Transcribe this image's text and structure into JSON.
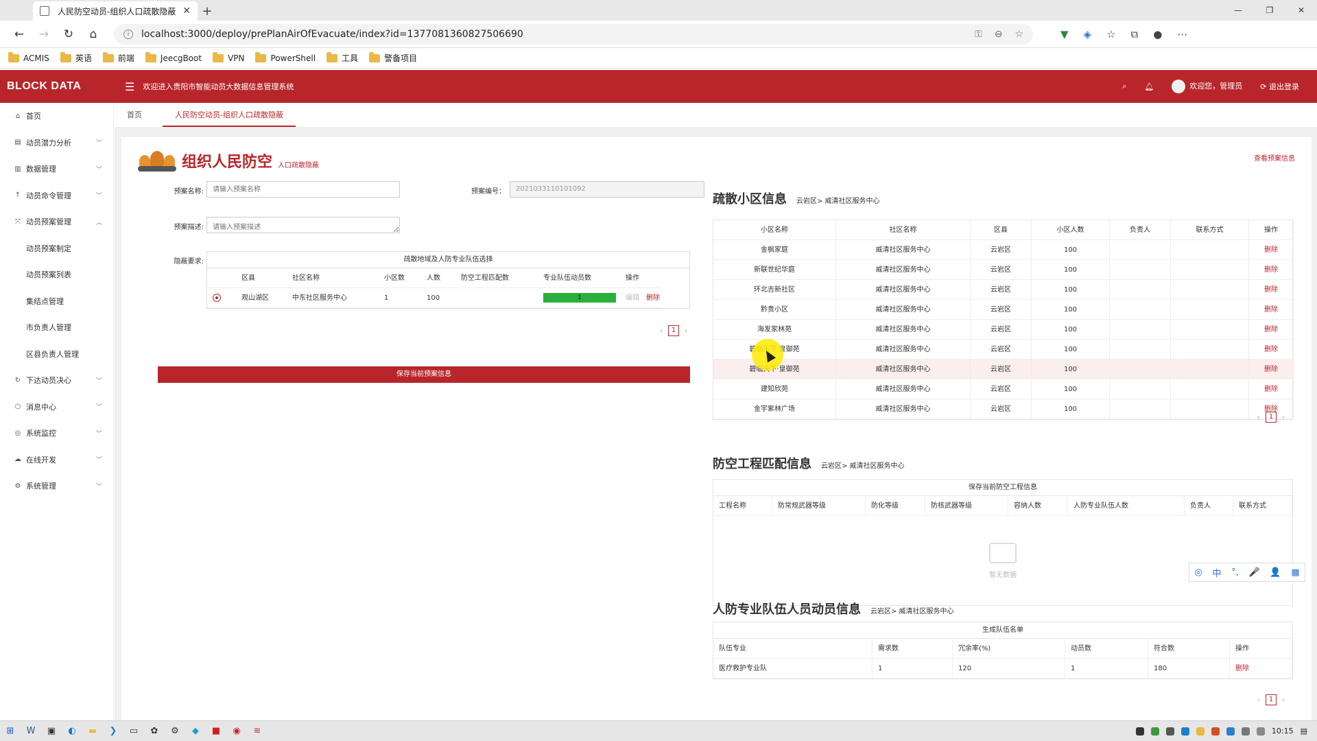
{
  "browser": {
    "tab_title": "人民防空动员-组织人口疏散隐蔽",
    "new_tab": "+",
    "url": "localhost:3000/deploy/prePlanAirOfEvacuate/index?id=1377081360827506690",
    "bookmarks": [
      "ACMIS",
      "英语",
      "前端",
      "JeecgBoot",
      "VPN",
      "PowerShell",
      "工具",
      "警备项目"
    ]
  },
  "app": {
    "brand": "BLOCK DATA",
    "welcome": "欢迎进入贵阳市智能动员大数据信息管理系统",
    "user_greeting": "欢迎您，管理员",
    "logout": "退出登录",
    "accent_color": "#b8262b"
  },
  "sidebar": {
    "items": [
      {
        "label": "首页",
        "icon": "home-icon"
      },
      {
        "label": "动员潜力分析",
        "icon": "chart-icon"
      },
      {
        "label": "数据管理",
        "icon": "bar-icon"
      },
      {
        "label": "动员命令管理",
        "icon": "arrow-up-icon"
      },
      {
        "label": "动员预案管理",
        "icon": "expand-icon"
      },
      {
        "label": "动员预案制定",
        "icon": ""
      },
      {
        "label": "动员预案列表",
        "icon": ""
      },
      {
        "label": "集结点管理",
        "icon": ""
      },
      {
        "label": "市负责人管理",
        "icon": ""
      },
      {
        "label": "区县负责人管理",
        "icon": ""
      },
      {
        "label": "下达动员决心",
        "icon": "refresh-icon"
      },
      {
        "label": "消息中心",
        "icon": "circle-icon"
      },
      {
        "label": "系统监控",
        "icon": "monitor-icon"
      },
      {
        "label": "在线开发",
        "icon": "cloud-icon"
      },
      {
        "label": "系统管理",
        "icon": "gear-icon"
      }
    ]
  },
  "breadcrumbs": {
    "home": "首页",
    "current": "人民防空动员-组织人口疏散隐蔽"
  },
  "page": {
    "title": "组织人民防空",
    "subtitle": "人口疏散隐蔽",
    "view_link": "查看预案信息"
  },
  "form": {
    "name_label": "预案名称:",
    "name_placeholder": "请输入预案名称",
    "code_label": "预案编号：",
    "code_value": "2021033110101092",
    "desc_label": "预案描述:",
    "desc_placeholder": "请输入预案描述",
    "req_label": "隐蔽要求:",
    "table_caption": "疏散地域及人防专业队伍选择",
    "columns": [
      "",
      "区县",
      "社区名称",
      "小区数",
      "人数",
      "防空工程匹配数",
      "专业队伍动员数",
      "操作"
    ],
    "row": {
      "district": "观山湖区",
      "community": "中东社区服务中心",
      "estates": "1",
      "people": "100",
      "match": "",
      "team": "1",
      "team_fraction": 1.0,
      "edit": "编辑",
      "delete": "删除"
    },
    "page": "1",
    "save_button": "保存当前预案信息"
  },
  "evac": {
    "title": "疏散小区信息",
    "path": "云岩区> 威清社区服务中心",
    "columns": [
      "小区名称",
      "社区名称",
      "区县",
      "小区人数",
      "负责人",
      "联系方式",
      "操作"
    ],
    "rows": [
      [
        "金枫家庭",
        "威清社区服务中心",
        "云岩区",
        "100",
        "",
        "",
        "删除"
      ],
      [
        "新联世纪华庭",
        "威清社区服务中心",
        "云岩区",
        "100",
        "",
        "",
        "删除"
      ],
      [
        "环北吉新社区",
        "威清社区服务中心",
        "云岩区",
        "100",
        "",
        "",
        "删除"
      ],
      [
        "黔贵小区",
        "威清社区服务中心",
        "云岩区",
        "100",
        "",
        "",
        "删除"
      ],
      [
        "海发家林苑",
        "威清社区服务中心",
        "云岩区",
        "100",
        "",
        "",
        "删除"
      ],
      [
        "碧临天下·皇御苑",
        "威清社区服务中心",
        "云岩区",
        "100",
        "",
        "",
        "删除"
      ],
      [
        "碧临天下·皇御苑",
        "威清社区服务中心",
        "云岩区",
        "100",
        "",
        "",
        "删除"
      ],
      [
        "建知欣苑",
        "威清社区服务中心",
        "云岩区",
        "100",
        "",
        "",
        "删除"
      ],
      [
        "金宇紫林广场",
        "威清社区服务中心",
        "云岩区",
        "100",
        "",
        "",
        "删除"
      ]
    ],
    "page": "1"
  },
  "engineering": {
    "title": "防空工程匹配信息",
    "path": "云岩区> 威清社区服务中心",
    "caption": "保存当前防空工程信息",
    "columns": [
      "工程名称",
      "防常规武器等级",
      "防化等级",
      "防核武器等级",
      "容纳人数",
      "人防专业队伍人数",
      "负责人",
      "联系方式"
    ],
    "empty": "暂无数据"
  },
  "teams": {
    "title": "人防专业队伍人员动员信息",
    "path": "云岩区> 威清社区服务中心",
    "caption": "生成队伍名单",
    "columns": [
      "队伍专业",
      "需求数",
      "冗余率(%)",
      "动员数",
      "符合数",
      "操作"
    ],
    "rows": [
      [
        "医疗救护专业队",
        "1",
        "120",
        "1",
        "180",
        "删除"
      ]
    ],
    "page": "1"
  },
  "ime": [
    "中",
    "°,",
    "🎤",
    "👤",
    "▦"
  ],
  "taskbar": {
    "time": "10:15"
  }
}
